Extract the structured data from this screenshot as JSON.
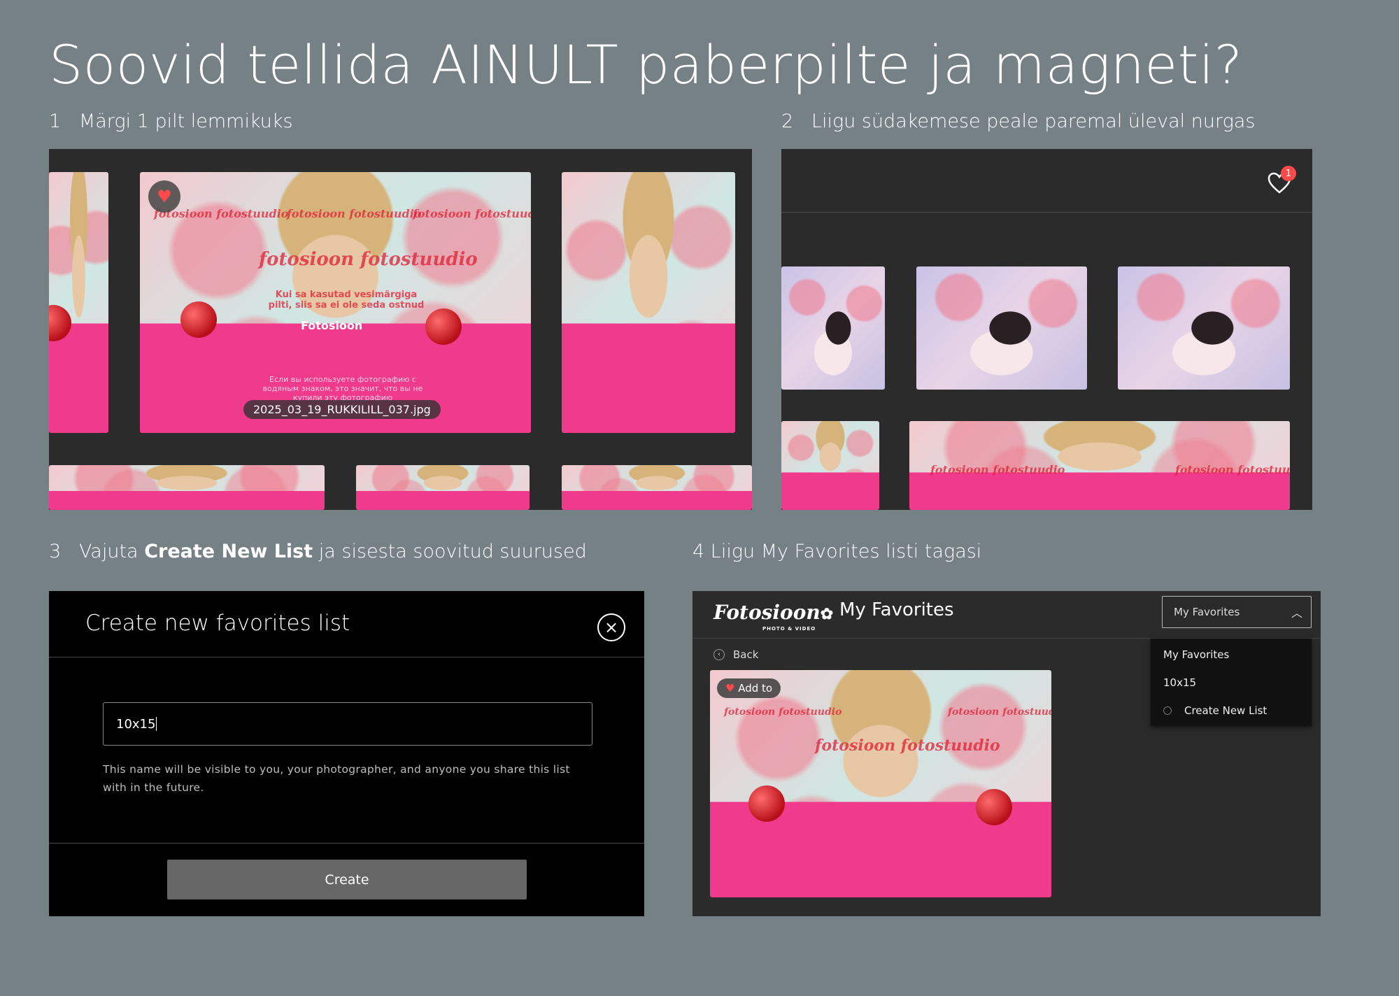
{
  "page": {
    "title": "Soovid tellida AINULT paberpilte ja magneti?"
  },
  "steps": {
    "s1": {
      "num": "1",
      "text": "Märgi 1 pilt lemmikuks"
    },
    "s2": {
      "num": "2",
      "text": "Liigu südakemese peale paremal üleval nurgas"
    },
    "s3": {
      "num": "3",
      "pre": "Vajuta ",
      "bold": "Create New List",
      "post": " ja sisesta soovitud suurused"
    },
    "s4": {
      "num": "4",
      "text": "Liigu  My Favorites listi tagasi"
    }
  },
  "panel1": {
    "filename": "2025_03_19_RUKKILILL_037.jpg",
    "watermark": "fotosioon fotostuudio",
    "notice_et": "Kui sa kasutad vesimärgiga pilti, siis sa ei ole seda ostnud",
    "brand": "Fotosioon",
    "notice_ru": "Если вы используете фотографию с водяным знаком, это значит, что вы не купили эту фотографию"
  },
  "panel2": {
    "fav_count": "1"
  },
  "modal": {
    "title": "Create new favorites list",
    "input_value": "10x15",
    "help_text": "This name will be visible to you, your photographer, and anyone you share this list with in the future.",
    "create_label": "Create"
  },
  "favorites": {
    "logo": "Fotosioon",
    "logo_sub": "PHOTO & VIDEO",
    "title": "My Favorites",
    "select_value": "My Favorites",
    "back_label": "Back",
    "add_to_label": "Add to",
    "dropdown_items": [
      "My Favorites",
      "10x15",
      "Create New List"
    ]
  },
  "colors": {
    "page_bg": "#758184",
    "panel_bg": "#2b2b2b",
    "modal_bg": "#000000",
    "heart": "#ff4a4a",
    "dress_pink": "#f03a8c"
  }
}
